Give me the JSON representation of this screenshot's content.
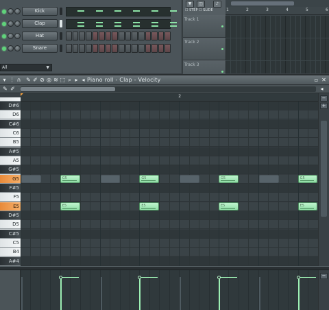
{
  "sequencer": {
    "channels": [
      {
        "label": "Kick",
        "kind": "piano",
        "selected": false
      },
      {
        "label": "Clap",
        "kind": "piano",
        "selected": true
      },
      {
        "label": "Hat",
        "kind": "steps",
        "selected": false
      },
      {
        "label": "Snare",
        "kind": "steps",
        "selected": false
      }
    ],
    "filter_value": "All",
    "filter_arrow": "▼"
  },
  "playlist": {
    "snap_label": "STEP",
    "slide_label": "SLIDE",
    "bars": [
      "1",
      "2",
      "3",
      "4",
      "5",
      "6"
    ],
    "tracks": [
      "Track 1",
      "Track 2",
      "Track 3"
    ]
  },
  "piano_roll": {
    "title": "Piano roll - Clap - Velocity",
    "ruler_marks": [
      "2"
    ],
    "keys": [
      {
        "label": "D#6",
        "type": "black",
        "active": false
      },
      {
        "label": "D6",
        "type": "white",
        "active": false
      },
      {
        "label": "C#6",
        "type": "black",
        "active": false
      },
      {
        "label": "C6",
        "type": "white",
        "active": false
      },
      {
        "label": "B5",
        "type": "white",
        "active": false
      },
      {
        "label": "A#5",
        "type": "black",
        "active": false
      },
      {
        "label": "A5",
        "type": "white",
        "active": false
      },
      {
        "label": "G#5",
        "type": "black",
        "active": false
      },
      {
        "label": "G5",
        "type": "white",
        "active": true
      },
      {
        "label": "F#5",
        "type": "black",
        "active": false
      },
      {
        "label": "F5",
        "type": "white",
        "active": false
      },
      {
        "label": "E5",
        "type": "white",
        "active": true
      },
      {
        "label": "D#5",
        "type": "black",
        "active": false
      },
      {
        "label": "D5",
        "type": "white",
        "active": false
      },
      {
        "label": "C#5",
        "type": "black",
        "active": false
      },
      {
        "label": "C5",
        "type": "white",
        "active": false
      },
      {
        "label": "B4",
        "type": "white",
        "active": false
      },
      {
        "label": "A#4",
        "type": "black",
        "active": false
      }
    ],
    "notes": [
      {
        "label": "G5",
        "pitch": "G5",
        "step": 1
      },
      {
        "label": "G5",
        "pitch": "G5",
        "step": 3
      },
      {
        "label": "G5",
        "pitch": "G5",
        "step": 5
      },
      {
        "label": "G5",
        "pitch": "G5",
        "step": 7
      },
      {
        "label": "E5",
        "pitch": "E5",
        "step": 1
      },
      {
        "label": "E5",
        "pitch": "E5",
        "step": 3
      },
      {
        "label": "E5",
        "pitch": "E5",
        "step": 5
      },
      {
        "label": "E5",
        "pitch": "E5",
        "step": 7
      }
    ],
    "ghost_notes": [
      {
        "pitch": "G5",
        "step": 0
      },
      {
        "pitch": "G5",
        "step": 2
      },
      {
        "pitch": "G5",
        "step": 4
      },
      {
        "pitch": "G5",
        "step": 6
      }
    ],
    "velocities": [
      1,
      1,
      1,
      1
    ]
  },
  "colors": {
    "note": "#a8ecbb",
    "active_key": "#f0a050",
    "led": "#5fd47a"
  }
}
